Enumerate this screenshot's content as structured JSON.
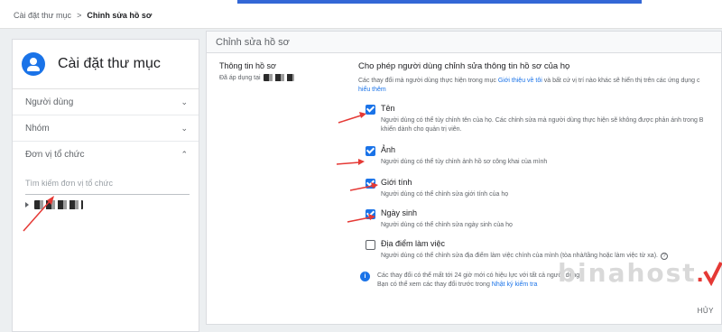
{
  "breadcrumb": {
    "parent": "Cài đặt thư mục",
    "separator": ">",
    "current": "Chỉnh sửa hồ sơ"
  },
  "sidebar": {
    "title": "Cài đặt thư mục",
    "items": [
      {
        "label": "Người dùng",
        "icon": "chevron-down-icon"
      },
      {
        "label": "Nhóm",
        "icon": "chevron-down-icon"
      },
      {
        "label": "Đơn vị tổ chức",
        "icon": "chevron-up-icon"
      }
    ],
    "search_placeholder": "Tìm kiếm đơn vị tổ chức"
  },
  "main": {
    "header": "Chỉnh sửa hồ sơ",
    "section_label": "Thông tin hồ sơ",
    "section_sub": "Đã áp dụng tại",
    "title": "Cho phép người dùng chỉnh sửa thông tin hồ sơ của họ",
    "desc_a": "Các thay đổi mà người dùng thực hiện trong mục ",
    "desc_link": "Giới thiệu về tôi",
    "desc_b": " và bất cứ vị trí nào khác sẽ hiển thị trên các ứng dụng c",
    "desc_link2": "hiểu thêm",
    "options": [
      {
        "label": "Tên",
        "checked": true,
        "desc": "Người dùng có thể tùy chỉnh tên của họ. Các chỉnh sửa mà người dùng thực hiện sẽ không được phản ánh trong B",
        "desc2": "khiển dành cho quản trị viên."
      },
      {
        "label": "Ảnh",
        "checked": true,
        "desc": "Người dùng có thể tùy chỉnh ảnh hồ sơ công khai của mình"
      },
      {
        "label": "Giới tính",
        "checked": true,
        "desc": "Người dùng có thể chỉnh sửa giới tính của họ"
      },
      {
        "label": "Ngày sinh",
        "checked": true,
        "desc": "Người dùng có thể chỉnh sửa ngày sinh của họ"
      },
      {
        "label": "Địa điểm làm việc",
        "checked": false,
        "desc": "Người dùng có thể chỉnh sửa địa điểm làm việc chính của mình (tòa nhà/tầng hoặc làm việc từ xa)."
      }
    ],
    "info_a": "Các thay đổi có thể mất tới 24 giờ mới có hiệu lực với tất cả người dùng.",
    "info_b": "Bạn có thể xem các thay đổi trước trong ",
    "info_link": "Nhật ký kiểm tra",
    "cancel_label": "HỦY"
  },
  "watermark": {
    "text": "binahost",
    "dot": "."
  },
  "colors": {
    "accent": "#1a73e8",
    "arrow": "#e53935"
  }
}
